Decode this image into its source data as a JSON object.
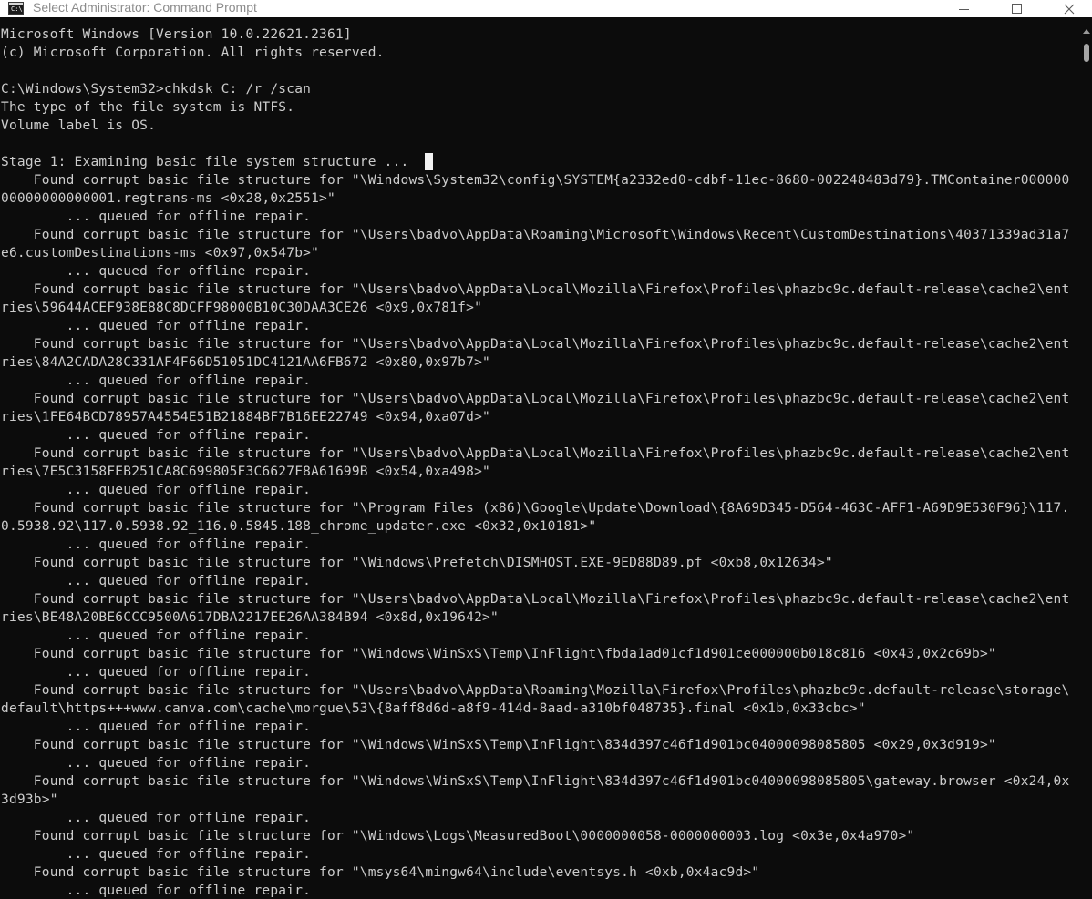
{
  "window": {
    "title": "Select Administrator: Command Prompt",
    "icon": "cmd-icon",
    "controls": [
      "minimize-icon",
      "maximize-icon",
      "close-icon"
    ]
  },
  "console": {
    "lines": [
      "Microsoft Windows [Version 10.0.22621.2361]",
      "(c) Microsoft Corporation. All rights reserved.",
      "",
      "C:\\Windows\\System32>chkdsk C: /r /scan",
      "The type of the file system is NTFS.",
      "Volume label is OS.",
      "",
      "Stage 1: Examining basic file system structure ...",
      "    Found corrupt basic file structure for \"\\Windows\\System32\\config\\SYSTEM{a2332ed0-cdbf-11ec-8680-002248483d79}.TMContainer000000",
      "00000000000001.regtrans-ms <0x28,0x2551>\"",
      "        ... queued for offline repair.",
      "    Found corrupt basic file structure for \"\\Users\\badvo\\AppData\\Roaming\\Microsoft\\Windows\\Recent\\CustomDestinations\\40371339ad31a7",
      "e6.customDestinations-ms <0x97,0x547b>\"",
      "        ... queued for offline repair.",
      "    Found corrupt basic file structure for \"\\Users\\badvo\\AppData\\Local\\Mozilla\\Firefox\\Profiles\\phazbc9c.default-release\\cache2\\ent",
      "ries\\59644ACEF938E88C8DCFF98000B10C30DAA3CE26 <0x9,0x781f>\"",
      "        ... queued for offline repair.",
      "    Found corrupt basic file structure for \"\\Users\\badvo\\AppData\\Local\\Mozilla\\Firefox\\Profiles\\phazbc9c.default-release\\cache2\\ent",
      "ries\\84A2CADA28C331AF4F66D51051DC4121AA6FB672 <0x80,0x97b7>\"",
      "        ... queued for offline repair.",
      "    Found corrupt basic file structure for \"\\Users\\badvo\\AppData\\Local\\Mozilla\\Firefox\\Profiles\\phazbc9c.default-release\\cache2\\ent",
      "ries\\1FE64BCD78957A4554E51B21884BF7B16EE22749 <0x94,0xa07d>\"",
      "        ... queued for offline repair.",
      "    Found corrupt basic file structure for \"\\Users\\badvo\\AppData\\Local\\Mozilla\\Firefox\\Profiles\\phazbc9c.default-release\\cache2\\ent",
      "ries\\7E5C3158FEB251CA8C699805F3C6627F8A61699B <0x54,0xa498>\"",
      "        ... queued for offline repair.",
      "    Found corrupt basic file structure for \"\\Program Files (x86)\\Google\\Update\\Download\\{8A69D345-D564-463C-AFF1-A69D9E530F96}\\117.",
      "0.5938.92\\117.0.5938.92_116.0.5845.188_chrome_updater.exe <0x32,0x10181>\"",
      "        ... queued for offline repair.",
      "    Found corrupt basic file structure for \"\\Windows\\Prefetch\\DISMHOST.EXE-9ED88D89.pf <0xb8,0x12634>\"",
      "        ... queued for offline repair.",
      "    Found corrupt basic file structure for \"\\Users\\badvo\\AppData\\Local\\Mozilla\\Firefox\\Profiles\\phazbc9c.default-release\\cache2\\ent",
      "ries\\BE48A20BE6CCC9500A617DBA2217EE26AA384B94 <0x8d,0x19642>\"",
      "        ... queued for offline repair.",
      "    Found corrupt basic file structure for \"\\Windows\\WinSxS\\Temp\\InFlight\\fbda1ad01cf1d901ce000000b018c816 <0x43,0x2c69b>\"",
      "        ... queued for offline repair.",
      "    Found corrupt basic file structure for \"\\Users\\badvo\\AppData\\Roaming\\Mozilla\\Firefox\\Profiles\\phazbc9c.default-release\\storage\\",
      "default\\https+++www.canva.com\\cache\\morgue\\53\\{8aff8d6d-a8f9-414d-8aad-a310bf048735}.final <0x1b,0x33cbc>\"",
      "        ... queued for offline repair.",
      "    Found corrupt basic file structure for \"\\Windows\\WinSxS\\Temp\\InFlight\\834d397c46f1d901bc04000098085805 <0x29,0x3d919>\"",
      "        ... queued for offline repair.",
      "    Found corrupt basic file structure for \"\\Windows\\WinSxS\\Temp\\InFlight\\834d397c46f1d901bc04000098085805\\gateway.browser <0x24,0x",
      "3d93b>\"",
      "        ... queued for offline repair.",
      "    Found corrupt basic file structure for \"\\Windows\\Logs\\MeasuredBoot\\0000000058-0000000003.log <0x3e,0x4a970>\"",
      "        ... queued for offline repair.",
      "    Found corrupt basic file structure for \"\\msys64\\mingw64\\include\\eventsys.h <0xb,0x4ac9d>\"",
      "        ... queued for offline repair."
    ],
    "cursor_line": 7
  }
}
